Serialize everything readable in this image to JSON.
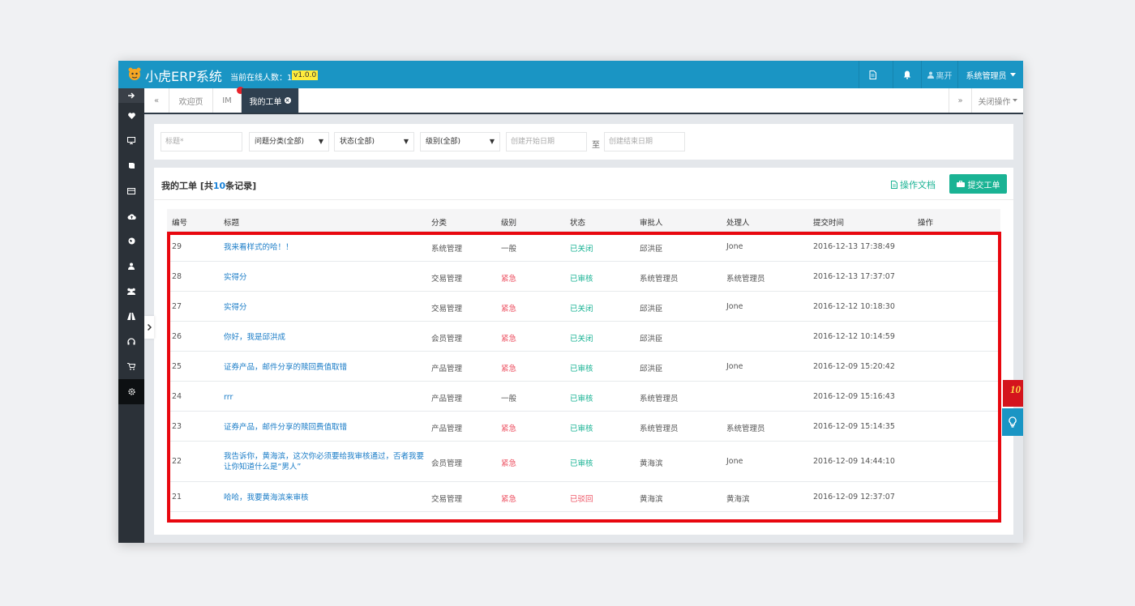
{
  "header": {
    "brand": "小虎ERP系统",
    "online_label": "当前在线人数：1",
    "version": "v1.0.0",
    "leave_label": "离开",
    "user_label": "系统管理员"
  },
  "sidebar": {
    "items": [
      "arrow-right-icon",
      "heart-icon",
      "monitor-icon",
      "book-icon",
      "list-icon",
      "cloud-upload-icon",
      "globe-icon",
      "user-icon",
      "users-icon",
      "road-icon",
      "headphones-icon",
      "cart-icon",
      "gear-icon"
    ]
  },
  "tabs": {
    "prev": "«",
    "next": "»",
    "items": [
      "欢迎页",
      "IM",
      "我的工单"
    ],
    "close_ops": "关闭操作"
  },
  "filter": {
    "title_placeholder": "标题*",
    "category": "问题分类(全部)",
    "status": "状态(全部)",
    "level": "级别(全部)",
    "start_date_placeholder": "创建开始日期",
    "to": "至",
    "end_date_placeholder": "创建结束日期"
  },
  "panel": {
    "title_prefix": "我的工单 [共",
    "record_count": "10",
    "title_suffix": "条记录]",
    "doc_label": "操作文档",
    "submit_label": "提交工单"
  },
  "table": {
    "columns": [
      "编号",
      "标题",
      "分类",
      "级别",
      "状态",
      "审批人",
      "处理人",
      "提交时间",
      "操作"
    ],
    "rows": [
      {
        "id": "29",
        "title": "我来看样式的哈！！",
        "category": "系统管理",
        "level": "一般",
        "status": "已关闭",
        "approver": "邱洪臣",
        "handler": "Jone",
        "time": "2016-12-13 17:38:49"
      },
      {
        "id": "28",
        "title": "实得分",
        "category": "交易管理",
        "level": "紧急",
        "status": "已审核",
        "approver": "系统管理员",
        "handler": "系统管理员",
        "time": "2016-12-13 17:37:07"
      },
      {
        "id": "27",
        "title": "实得分",
        "category": "交易管理",
        "level": "紧急",
        "status": "已关闭",
        "approver": "邱洪臣",
        "handler": "Jone",
        "time": "2016-12-12 10:18:30"
      },
      {
        "id": "26",
        "title": "你好，我是邱洪成",
        "category": "会员管理",
        "level": "紧急",
        "status": "已关闭",
        "approver": "邱洪臣",
        "handler": "",
        "time": "2016-12-12 10:14:59"
      },
      {
        "id": "25",
        "title": "证券产品，邮件分享的赎回费值取错",
        "category": "产品管理",
        "level": "紧急",
        "status": "已审核",
        "approver": "邱洪臣",
        "handler": "Jone",
        "time": "2016-12-09 15:20:42"
      },
      {
        "id": "24",
        "title": "rrr",
        "category": "产品管理",
        "level": "一般",
        "status": "已审核",
        "approver": "系统管理员",
        "handler": "",
        "time": "2016-12-09 15:16:43"
      },
      {
        "id": "23",
        "title": "证券产品，邮件分享的赎回费值取错",
        "category": "产品管理",
        "level": "紧急",
        "status": "已审核",
        "approver": "系统管理员",
        "handler": "系统管理员",
        "time": "2016-12-09 15:14:35"
      },
      {
        "id": "22",
        "title": "我告诉你，黄海滨，这次你必须要给我审核通过，否者我要让你知道什么是“男人”",
        "category": "会员管理",
        "level": "紧急",
        "status": "已审核",
        "approver": "黄海滨",
        "handler": "Jone",
        "time": "2016-12-09 14:44:10"
      },
      {
        "id": "21",
        "title": "哈哈，我要黄海滨来审核",
        "category": "交易管理",
        "level": "紧急",
        "status": "已驳回",
        "approver": "黄海滨",
        "handler": "黄海滨",
        "time": "2016-12-09 12:37:07"
      }
    ]
  },
  "colors": {
    "header_bg": "#1a95c4",
    "sidebar_bg": "#2b3138",
    "accent_green": "#1ab394",
    "urgent_red": "#ed5565",
    "link_blue": "#1a7cc7",
    "annotation_red": "#e8070f"
  },
  "promo": {
    "text": "10"
  }
}
